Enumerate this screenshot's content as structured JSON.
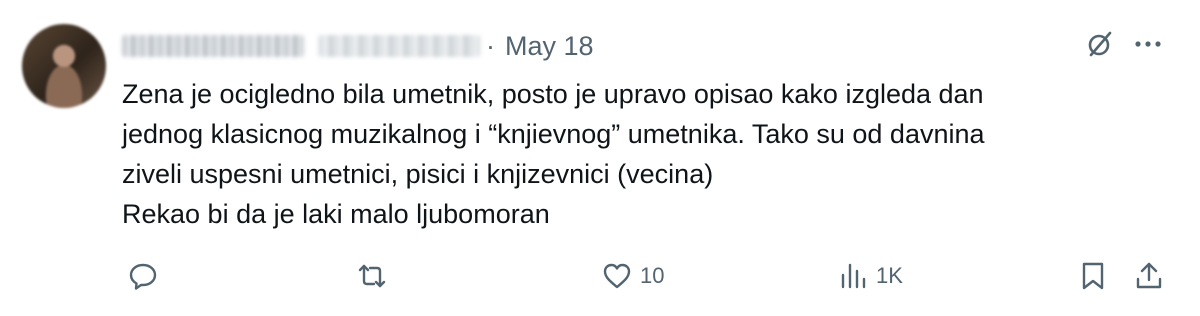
{
  "tweet": {
    "author_name": "",
    "author_handle": "",
    "separator": "·",
    "date": "May 18",
    "text_lines": [
      "Zena je ocigledno bila umetnik, posto je upravo opisao kako izgleda dan",
      "jednog klasicnog muzikalnog i “knjievnog” umetnika.  Tako su od davnina",
      "ziveli uspesni umetnici, pisici i knjizevnici (vecina)",
      "Rekao bi da je laki malo ljubomoran"
    ],
    "actions": {
      "reply_count": "",
      "retweet_count": "",
      "like_count": "10",
      "view_count": "1K"
    }
  },
  "icons": {
    "grok": "grok-icon",
    "more": "more-icon",
    "reply": "reply-icon",
    "retweet": "retweet-icon",
    "like": "heart-icon",
    "views": "views-icon",
    "bookmark": "bookmark-icon",
    "share": "share-icon"
  },
  "colors": {
    "text": "#0f1419",
    "muted": "#536471",
    "background": "#ffffff"
  }
}
